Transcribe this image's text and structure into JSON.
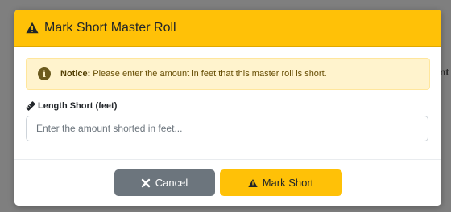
{
  "background": {
    "partial_text": "nt"
  },
  "modal": {
    "title": "Mark Short Master Roll",
    "title_icon": "warning-triangle-icon",
    "header_color": "#ffc107"
  },
  "notice": {
    "icon": "info-circle-icon",
    "label": "Notice:",
    "text": "Please enter the amount in feet that this master roll is short."
  },
  "field": {
    "icon": "ruler-icon",
    "label": "Length Short (feet)",
    "value": "",
    "placeholder": "Enter the amount shorted in feet..."
  },
  "footer": {
    "cancel_label": "Cancel",
    "cancel_icon": "close-icon",
    "mark_label": "Mark Short",
    "mark_icon": "warning-triangle-icon"
  }
}
